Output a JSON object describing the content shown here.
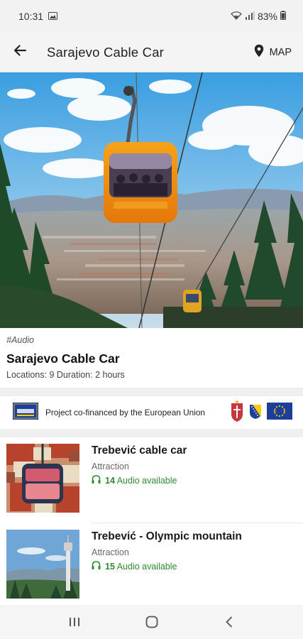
{
  "status_bar": {
    "time": "10:31",
    "battery": "83%",
    "icons": [
      "gallery-icon",
      "wifi-icon",
      "signal-icon",
      "battery-icon"
    ]
  },
  "app_bar": {
    "title": "Sarajevo Cable Car",
    "map_label": "MAP",
    "icons": [
      "back-arrow-icon",
      "map-pin-icon"
    ]
  },
  "tour": {
    "tag": "#Audio",
    "title": "Sarajevo Cable Car",
    "meta": "Locations: 9 Duration: 2 hours"
  },
  "eu_banner": {
    "text": "Project co-financed by the European Union"
  },
  "locations": [
    {
      "name": "Trebević cable car",
      "category": "Attraction",
      "audio_count": "14",
      "audio_label": "Audio available"
    },
    {
      "name": "Trebević - Olympic mountain",
      "category": "Attraction",
      "audio_count": "15",
      "audio_label": "Audio available"
    }
  ],
  "colors": {
    "accent_green": "#2e8b2e",
    "gondola_orange": "#f08a0c",
    "eu_blue": "#1d3f9a"
  }
}
